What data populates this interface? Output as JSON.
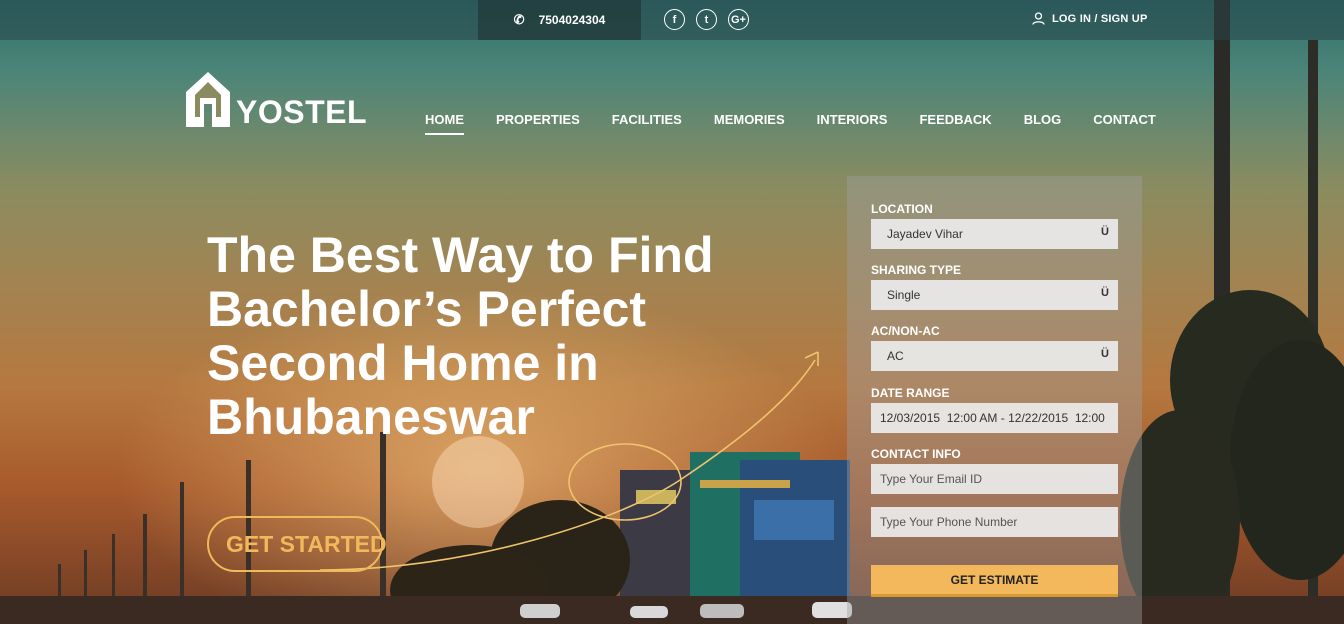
{
  "topbar": {
    "phone": "7504024304",
    "social": [
      {
        "icon": "facebook-icon",
        "glyph": "f"
      },
      {
        "icon": "twitter-icon",
        "glyph": "t"
      },
      {
        "icon": "google-plus-icon",
        "glyph": "G+"
      }
    ],
    "login_label": "LOG IN / SIGN UP"
  },
  "logo": {
    "text": "YOSTEL"
  },
  "nav": {
    "items": [
      "HOME",
      "PROPERTIES",
      "FACILITIES",
      "MEMORIES",
      "INTERIORS",
      "FEEDBACK",
      "BLOG",
      "CONTACT"
    ],
    "active": "HOME"
  },
  "hero": {
    "headline": "The Best Way to Find Bachelor’s Perfect Second Home in Bhubaneswar",
    "cta_label": "GET STARTED"
  },
  "form": {
    "location_label": "LOCATION",
    "location_value": "Jayadev Vihar",
    "sharing_label": "SHARING TYPE",
    "sharing_value": "Single",
    "ac_label": "AC/NON-AC",
    "ac_value": "AC",
    "date_label": "DATE RANGE",
    "date_value": "12/03/2015  12:00 AM - 12/22/2015  12:00",
    "contact_label": "CONTACT INFO",
    "email_placeholder": "Type Your Email ID",
    "phone_placeholder": "Type Your Phone Number",
    "submit_label": "GET ESTIMATE",
    "caret": "Ü"
  },
  "colors": {
    "accent": "#f3b85c",
    "topbar": "#2f5a5c"
  }
}
